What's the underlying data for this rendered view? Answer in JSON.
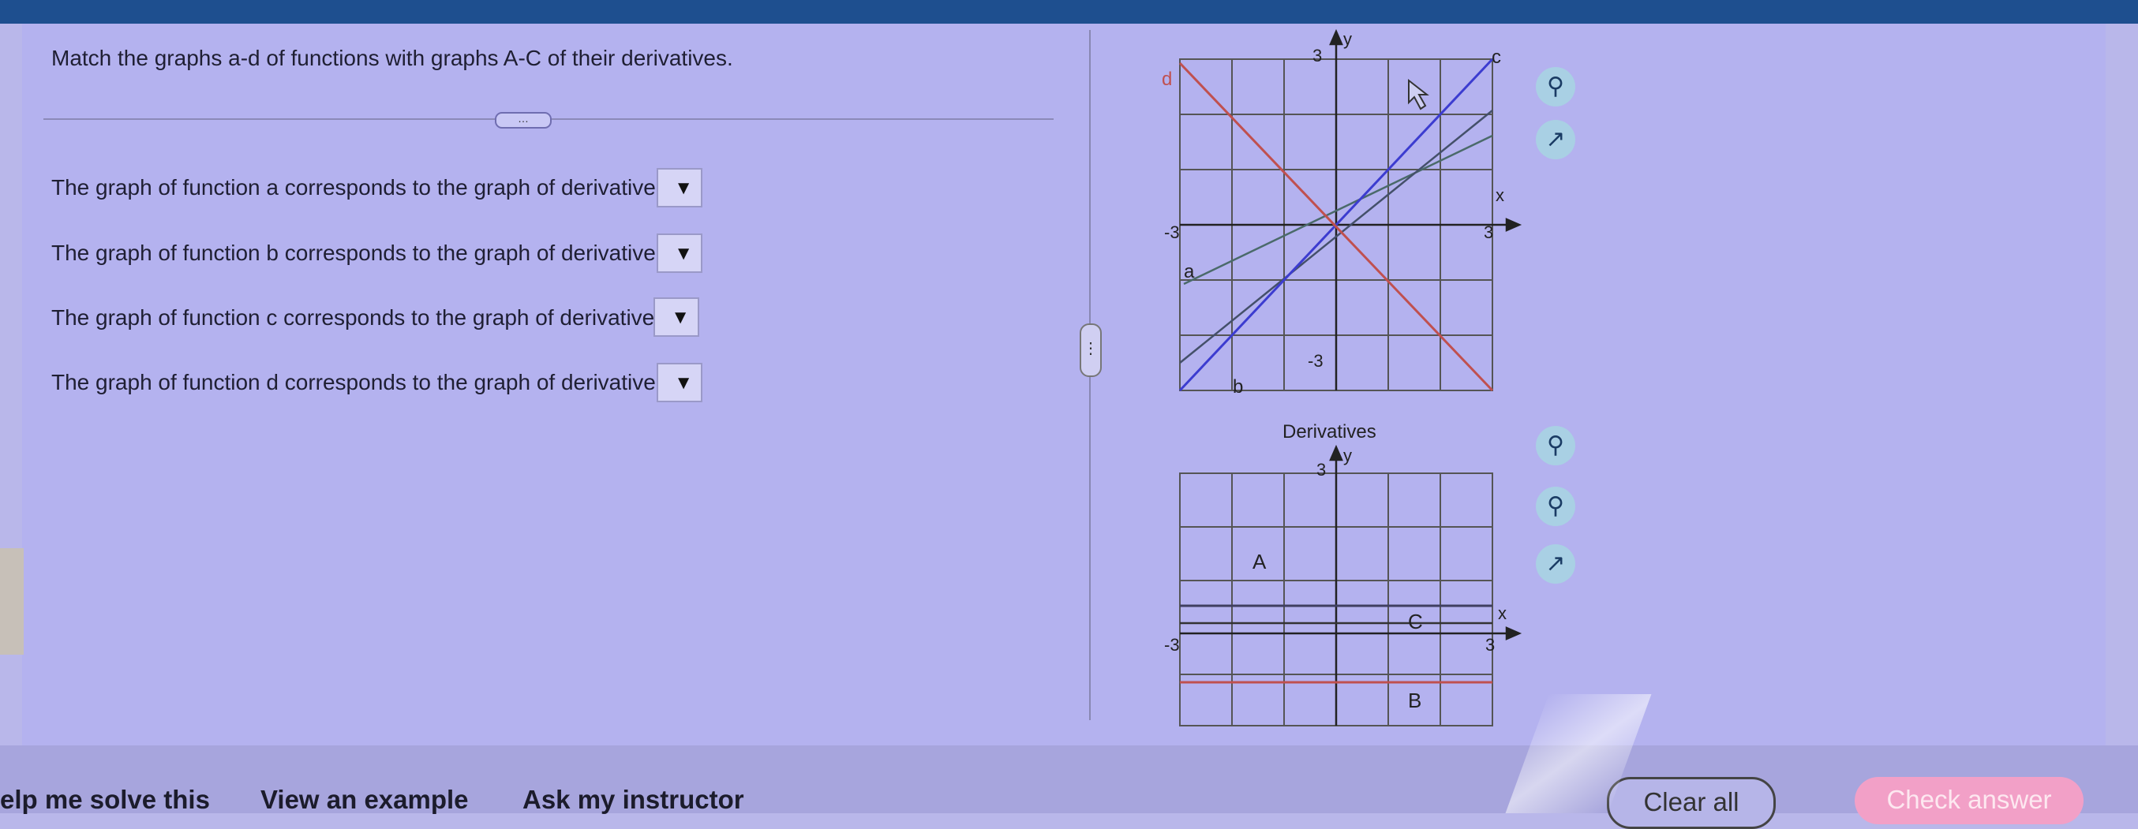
{
  "question": {
    "instructions": "Match the graphs a-d of functions with graphs A-C of their derivatives.",
    "more_label": "…",
    "rows": [
      {
        "text": "The graph of function a corresponds to the graph of derivative",
        "selected": ""
      },
      {
        "text": "The graph of function b corresponds to the graph of derivative",
        "selected": ""
      },
      {
        "text": "The graph of function c corresponds to the graph of derivative",
        "selected": ""
      },
      {
        "text": "The graph of function d corresponds to the graph of derivative",
        "selected": ""
      }
    ],
    "dropdown_arrow": "▼"
  },
  "functions_graph": {
    "y_label": "y",
    "x_label": "x",
    "y_top_tick": "3",
    "y_bottom_tick": "-3",
    "x_left_tick": "-3",
    "x_right_tick": "3",
    "curve_labels": {
      "a": "a",
      "b": "b",
      "c": "c",
      "d": "d"
    },
    "colors": {
      "a": "#4a6a6a",
      "b": "#44506a",
      "c": "#3c3cd0",
      "d": "#c0504f"
    }
  },
  "derivatives_graph": {
    "title": "Derivatives",
    "y_label": "y",
    "x_label": "x",
    "y_top_tick": "3",
    "x_left_tick": "-3",
    "x_right_tick": "3",
    "labels": {
      "A": "A",
      "B": "B",
      "C": "C"
    },
    "colors": {
      "A": "#3f3f60",
      "B": "#c0504f",
      "C": "#333333"
    }
  },
  "tools": {
    "zoom_in_icon": "zoom-in-icon",
    "zoom_out_icon": "zoom-out-icon",
    "popout_icon": "popout-icon"
  },
  "footer": {
    "help": "elp me solve this",
    "example": "View an example",
    "instructor": "Ask my instructor",
    "clear_all": "Clear all",
    "check_answer": "Check answer"
  }
}
